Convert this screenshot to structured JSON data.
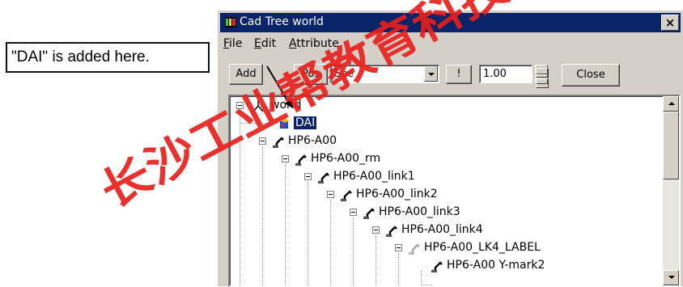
{
  "callout": {
    "text": "\"DAI\" is added here."
  },
  "window": {
    "title": "Cad Tree world",
    "close_glyph": "×",
    "menus": [
      {
        "label": "File",
        "key": "F",
        "rest": "ile"
      },
      {
        "label": "Edit",
        "key": "E",
        "rest": "dit"
      },
      {
        "label": "Attribute",
        "key": "A",
        "rest": "ttribute"
      }
    ]
  },
  "toolbar": {
    "add_label": "Add",
    "pos_label": "Pos",
    "see_value": "See",
    "bang_label": "!",
    "scale_value": "1.00",
    "close_label": "Close"
  },
  "tree": {
    "nodes": [
      {
        "label": "world",
        "icon": "world-axes-icon"
      },
      {
        "label": "DAI",
        "icon": "dai-part-icon",
        "selected": true
      },
      {
        "label": "HP6-A00",
        "icon": "robot-arm-icon"
      },
      {
        "label": "HP6-A00_rm",
        "icon": "robot-arm-icon"
      },
      {
        "label": "HP6-A00_link1",
        "icon": "robot-arm-icon"
      },
      {
        "label": "HP6-A00_link2",
        "icon": "robot-arm-icon"
      },
      {
        "label": "HP6-A00_link3",
        "icon": "robot-arm-icon"
      },
      {
        "label": "HP6-A00_link4",
        "icon": "robot-arm-icon"
      },
      {
        "label": "HP6-A00_LK4_LABEL",
        "icon": "robot-arm-grey-icon"
      },
      {
        "label": "HP6-A00 Y-mark2",
        "icon": "robot-arm-icon"
      }
    ]
  },
  "watermark": {
    "text": "长沙工业帮教育科技",
    "color": "#e8201c"
  },
  "colors": {
    "titlebar": "#0a246a",
    "selection": "#0a246a",
    "face": "#d4d0c8"
  }
}
